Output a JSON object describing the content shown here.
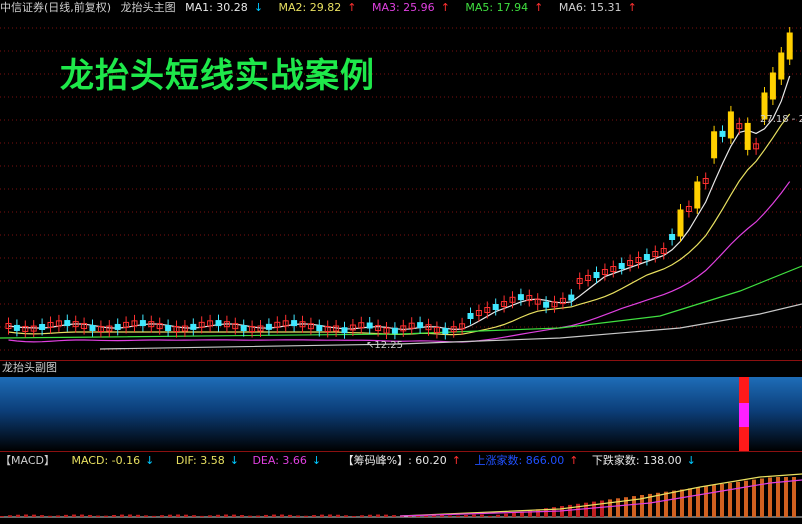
{
  "header": {
    "stock": "中信证券(日线,前复权)",
    "indicator": "龙抬头主图",
    "ma1": {
      "label": "MA1: 30.28",
      "arrow": "↓",
      "color": "#e8e8e8"
    },
    "ma2": {
      "label": "MA2: 29.82",
      "arrow": "↑",
      "color": "#e8e060"
    },
    "ma3": {
      "label": "MA3: 25.96",
      "arrow": "↑",
      "color": "#e040e0"
    },
    "ma5": {
      "label": "MA5: 17.94",
      "arrow": "↑",
      "color": "#40e040"
    },
    "ma6": {
      "label": "MA6: 15.31",
      "arrow": "↑",
      "color": "#d0d0d0"
    }
  },
  "overlay_title": "龙抬头短线实战案例",
  "price_labels": {
    "low": "12.25",
    "high": "27.18 - 2"
  },
  "subchart_title": "龙抬头副图",
  "macd_header": {
    "macd": "【MACD】",
    "macd_value": "MACD: -0.16",
    "macd_arrow": "↓",
    "dif": "DIF: 3.58",
    "dif_arrow": "↓",
    "dea": "DEA: 3.66",
    "dea_arrow": "↓",
    "chip": "【筹码峰%】: 60.20",
    "chip_arrow": "↑",
    "up_count": "上涨家数: 866.00",
    "up_arrow": "↑",
    "down_count": "下跌家数: 138.00",
    "down_arrow": "↓"
  },
  "colors": {
    "up_candle": "#ff3030",
    "down_candle": "#40e8ff",
    "strong_candle": "#ffd000",
    "grid": "#8b1010"
  }
}
